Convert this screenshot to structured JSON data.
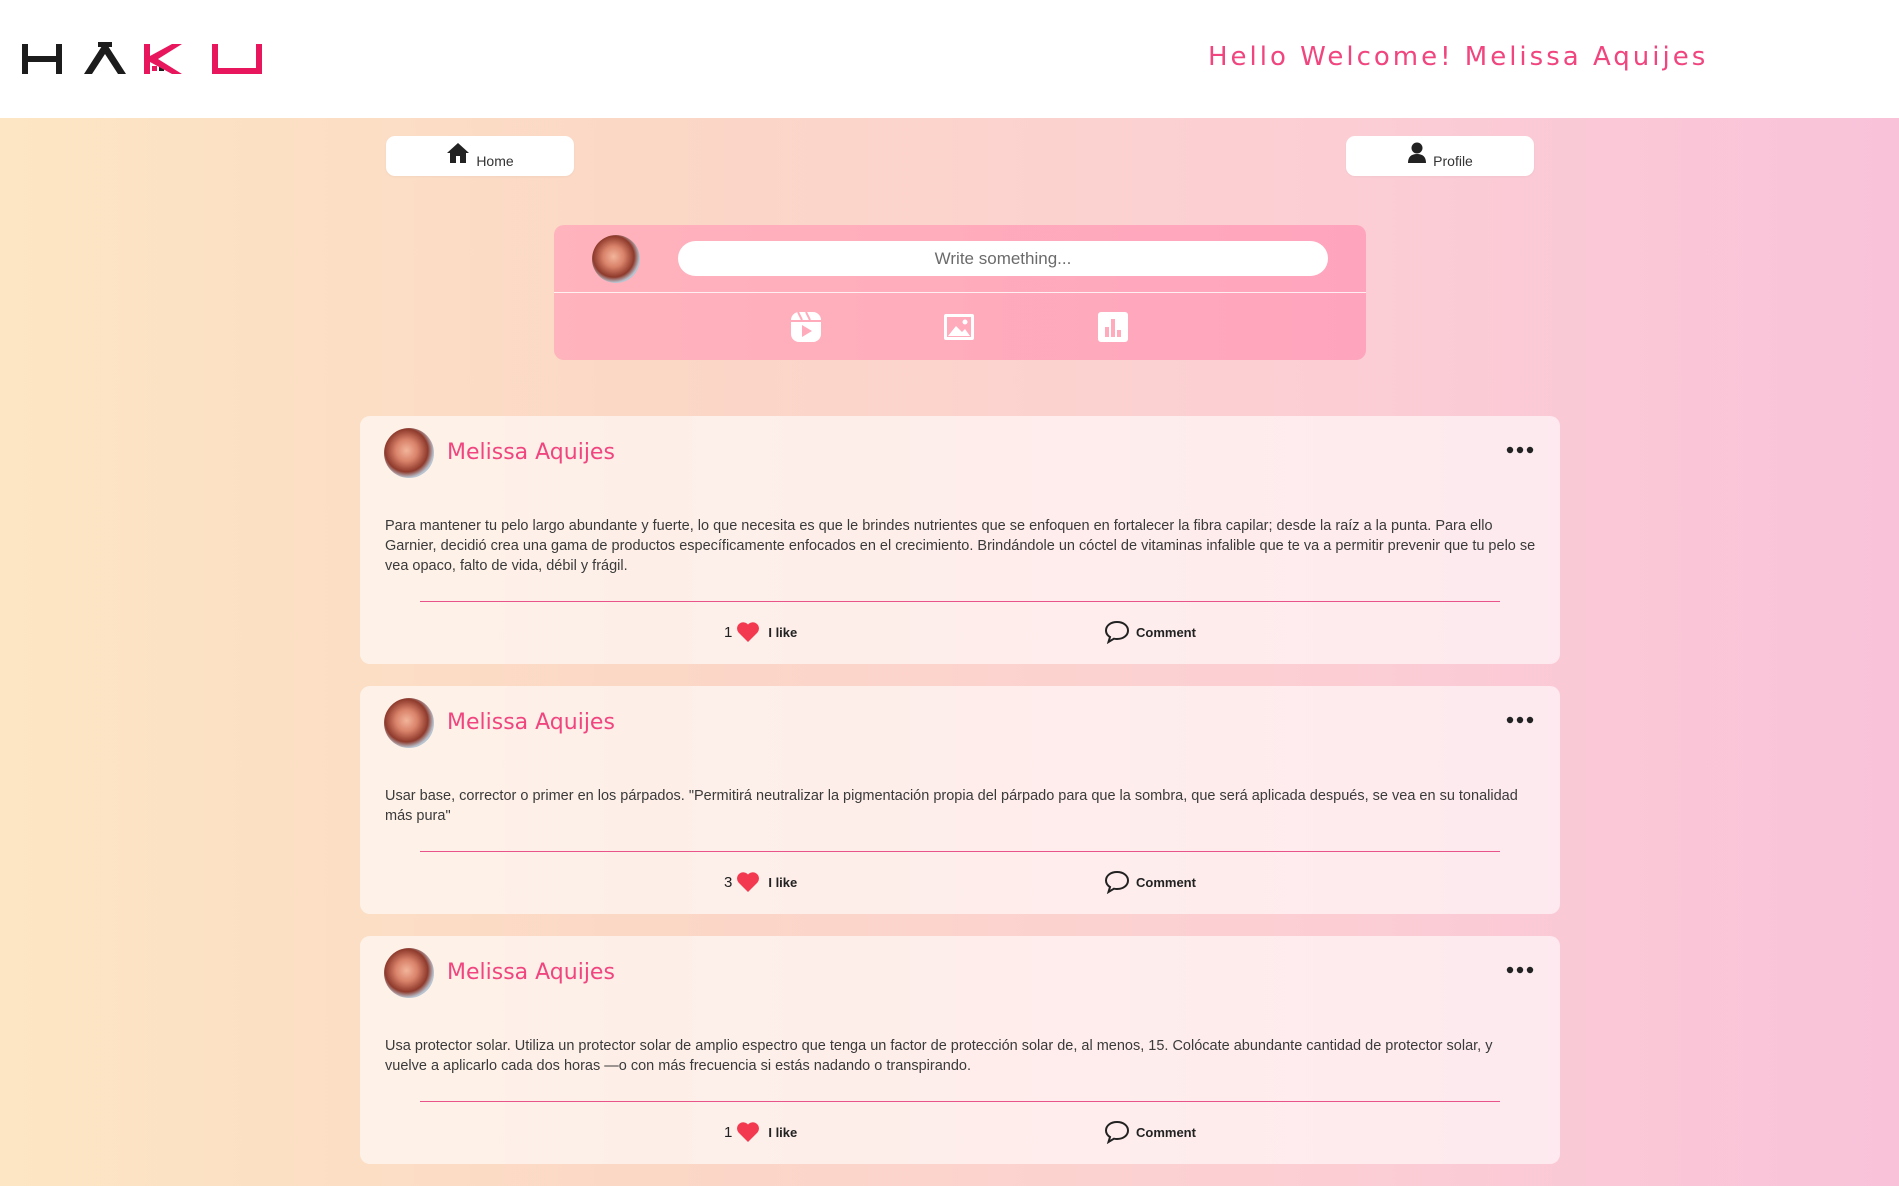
{
  "header": {
    "logo_text": "HAKU",
    "welcome": "Hello Welcome! Melissa Aquijes"
  },
  "nav": {
    "home_label": "Home",
    "profile_label": "Profile"
  },
  "composer": {
    "placeholder": "Write something..."
  },
  "posts": [
    {
      "author": "Melissa Aquijes",
      "text": "Para mantener tu pelo largo abundante y fuerte, lo que necesita es que le brindes nutrientes que se enfoquen en fortalecer la fibra capilar; desde la raíz a la punta. Para ello Garnier, decidió crea una gama de productos específicamente enfocados en el crecimiento. Brindándole un cóctel de vitaminas infalible que te va a permitir prevenir que tu pelo se vea opaco, falto de vida, débil y frágil.",
      "likes": "1",
      "like_label": "I like",
      "comment_label": "Comment"
    },
    {
      "author": "Melissa Aquijes",
      "text": "Usar base, corrector o primer en los párpados. \"Permitirá neutralizar la pigmentación propia del párpado para que la sombra, que será aplicada después, se vea en su tonalidad más pura\"",
      "likes": "3",
      "like_label": "I like",
      "comment_label": "Comment"
    },
    {
      "author": "Melissa Aquijes",
      "text": "Usa protector solar. Utiliza un protector solar de amplio espectro que tenga un factor de protección solar de, al menos, 15. Colócate abundante cantidad de protector solar, y vuelve a aplicarlo cada dos horas —o con más frecuencia si estás nadando o transpirando.",
      "likes": "1",
      "like_label": "I like",
      "comment_label": "Comment"
    }
  ],
  "colors": {
    "accent": "#f0457f",
    "brand_dark": "#222222",
    "brand_pink": "#e8175d",
    "heart": "#f2394f"
  },
  "icons": {
    "home": "home-icon",
    "profile": "user-icon",
    "reel": "video-reel-icon",
    "image": "image-icon",
    "chart": "bar-chart-icon",
    "more": "more-dots-icon",
    "heart": "heart-icon",
    "comment": "comment-bubble-icon"
  }
}
